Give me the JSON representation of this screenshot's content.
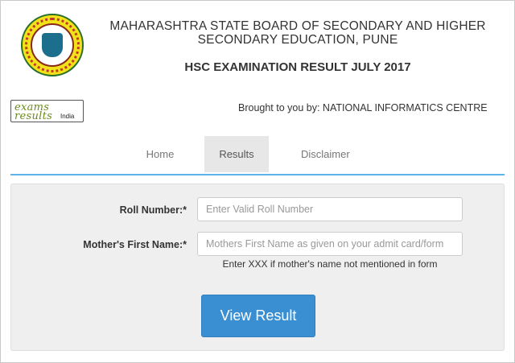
{
  "header": {
    "board_line1": "MAHARASHTRA STATE BOARD OF SECONDARY AND HIGHER",
    "board_line2": "SECONDARY EDUCATION, PUNE",
    "exam_title": "HSC EXAMINATION RESULT JULY 2017",
    "brought_by": "Brought to you by: NATIONAL INFORMATICS CENTRE"
  },
  "logo": {
    "exams": "exams",
    "results": "results",
    "india": "India"
  },
  "nav": {
    "home": "Home",
    "results": "Results",
    "disclaimer": "Disclaimer"
  },
  "form": {
    "roll_label": "Roll Number:*",
    "roll_placeholder": "Enter Valid Roll Number",
    "mother_label": "Mother's First Name:*",
    "mother_placeholder": "Mothers First Name as given on your admit card/form",
    "hint": "Enter XXX if mother's name not mentioned in form",
    "submit_label": "View Result"
  },
  "colors": {
    "accent": "#3a8fd3",
    "nav_line": "#5fb3e8",
    "panel_bg": "#efefef"
  }
}
